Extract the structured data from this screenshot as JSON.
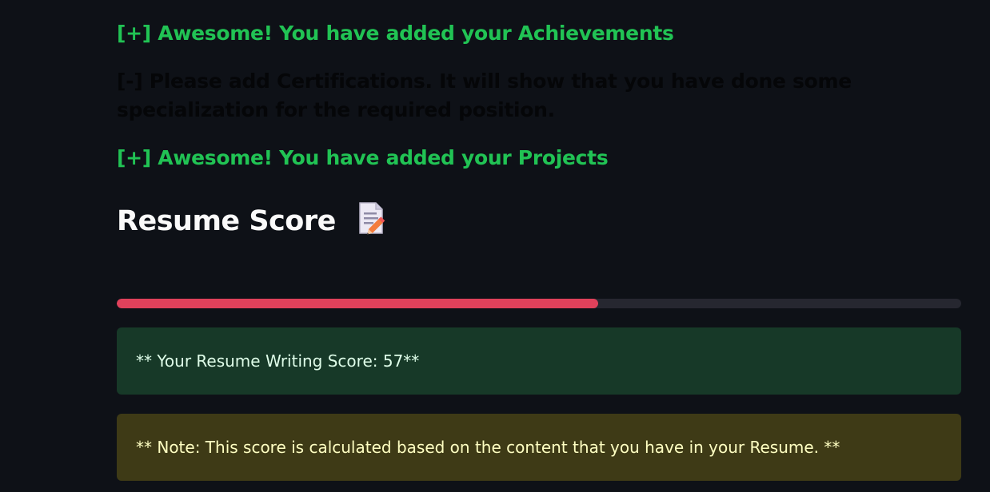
{
  "messages": {
    "achievements": "[+] Awesome! You have added your Achievements",
    "certifications": "[-] Please add Certifications. It will show that you have done some specialization for the required position.",
    "projects": "[+] Awesome! You have added your Projects"
  },
  "score_section": {
    "heading": "Resume Score",
    "heading_icon": "memo-pencil-icon",
    "progress_percent": 57,
    "progress_color": "#e0415b",
    "score_text": "** Your Resume Writing Score: 57**",
    "note_text": "** Note: This score is calculated based on the content that you have in your Resume. **"
  },
  "colors": {
    "background": "#0e1117",
    "success_text": "#21c354",
    "success_box": "#173928",
    "warning_box": "#3e3a16"
  }
}
